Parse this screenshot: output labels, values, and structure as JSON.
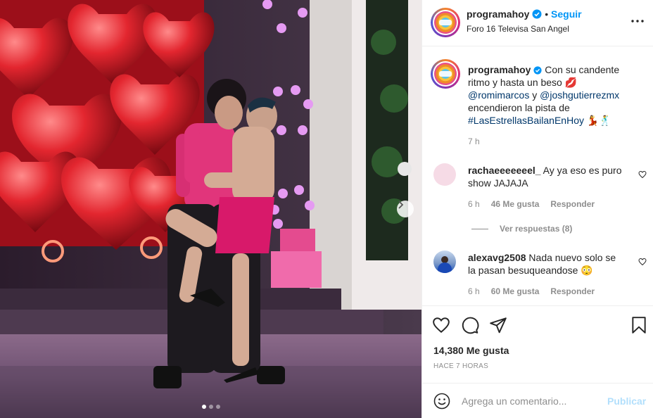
{
  "post": {
    "username": "programahoy",
    "follow_label": "Seguir",
    "location": "Foro 16 Televisa San Angel",
    "caption": {
      "line1": "Con su candente",
      "line2": "ritmo y hasta un beso 💋",
      "mention1": "@romimarcos",
      "conj": "y",
      "mention2": "@joshgutierrezmx",
      "line4": "encendieron la pista de",
      "hashtag": "#LasEstrellasBailanEnHoy",
      "emojis": "💃🕺",
      "time": "7 h"
    },
    "comments": [
      {
        "username": "rachaeeeeeeel_",
        "text_line1": "Ay ya eso es puro",
        "text_line2": "show JAJAJA",
        "time": "6 h",
        "likes": "46 Me gusta",
        "reply_label": "Responder",
        "view_replies": "Ver respuestas (8)"
      },
      {
        "username": "alexavg2508",
        "text_line1": "Nada nuevo solo se",
        "text_line2": "la pasan besuqueandose 😳",
        "time": "6 h",
        "likes": "60 Me gusta",
        "reply_label": "Responder"
      }
    ],
    "like_count": "14,380 Me gusta",
    "posted_ago": "HACE 7 HORAS",
    "comment_placeholder": "Agrega un comentario...",
    "publish_label": "Publicar",
    "carousel": {
      "count": 3,
      "active": 1
    }
  },
  "icons": {
    "verified": "verified-badge-icon",
    "more": "more-options-icon",
    "like": "heart-icon",
    "comment": "comment-icon",
    "share": "paper-plane-icon",
    "save": "bookmark-icon",
    "emoji": "smiley-icon",
    "next": "chevron-right-icon"
  },
  "colors": {
    "accent": "#0095f6",
    "link": "#00376b",
    "muted": "#8e8e8e",
    "publish_disabled": "#b2dffc"
  }
}
